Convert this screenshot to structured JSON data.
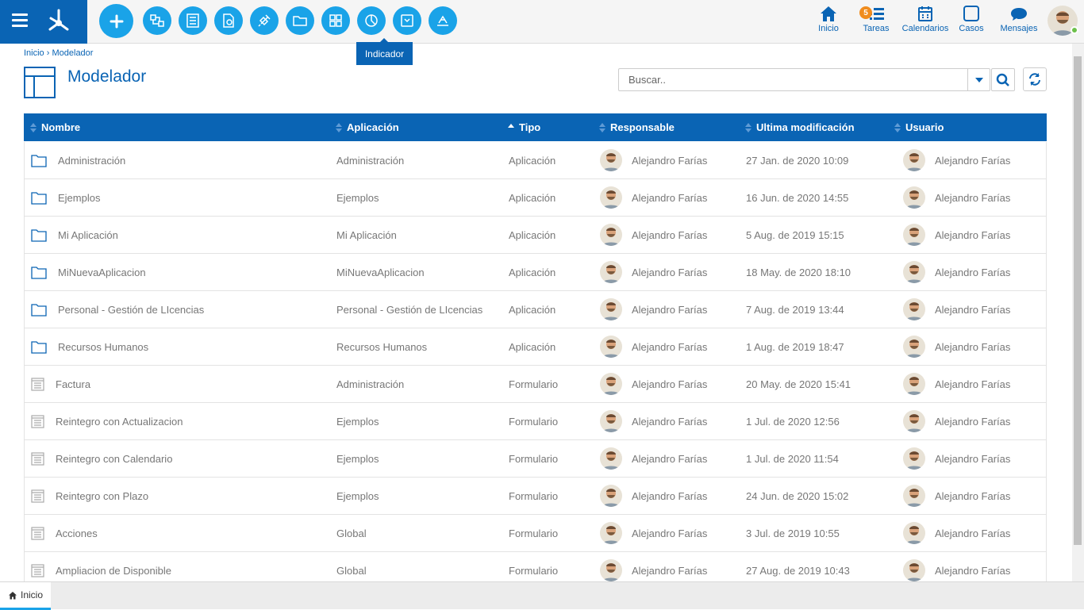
{
  "topbar": {
    "tooltip": "Indicador",
    "nav": [
      {
        "label": "Inicio",
        "icon": "home-icon"
      },
      {
        "label": "Tareas",
        "icon": "tasks-icon",
        "badge": "5"
      },
      {
        "label": "Calendarios",
        "icon": "calendar-icon"
      },
      {
        "label": "Casos",
        "icon": "cases-icon"
      },
      {
        "label": "Mensajes",
        "icon": "messages-icon"
      }
    ],
    "accent_color": "#0a64b4",
    "tool_color": "#1aa3e8"
  },
  "breadcrumb": {
    "home": "Inicio",
    "separator": "›",
    "current": "Modelador"
  },
  "page": {
    "title": "Modelador"
  },
  "search": {
    "placeholder": "Buscar.."
  },
  "table": {
    "headers": [
      "Nombre",
      "Aplicación",
      "Tipo",
      "Responsable",
      "Ultima modificación",
      "Usuario"
    ],
    "rows": [
      {
        "icon": "folder-icon",
        "name": "Administración",
        "app": "Administración",
        "type": "Aplicación",
        "resp": "Alejandro Farías",
        "mod": "27 Jan. de 2020 10:09",
        "user": "Alejandro Farías"
      },
      {
        "icon": "folder-icon",
        "name": "Ejemplos",
        "app": "Ejemplos",
        "type": "Aplicación",
        "resp": "Alejandro Farías",
        "mod": "16 Jun. de 2020 14:55",
        "user": "Alejandro Farías"
      },
      {
        "icon": "folder-icon",
        "name": "Mi Aplicación",
        "app": "Mi Aplicación",
        "type": "Aplicación",
        "resp": "Alejandro Farías",
        "mod": "5 Aug. de 2019 15:15",
        "user": "Alejandro Farías"
      },
      {
        "icon": "folder-icon",
        "name": "MiNuevaAplicacion",
        "app": "MiNuevaAplicacion",
        "type": "Aplicación",
        "resp": "Alejandro Farías",
        "mod": "18 May. de 2020 18:10",
        "user": "Alejandro Farías"
      },
      {
        "icon": "folder-icon",
        "name": "Personal - Gestión de LIcencias",
        "app": "Personal - Gestión de LIcencias",
        "type": "Aplicación",
        "resp": "Alejandro Farías",
        "mod": "7 Aug. de 2019 13:44",
        "user": "Alejandro Farías"
      },
      {
        "icon": "folder-icon",
        "name": "Recursos Humanos",
        "app": "Recursos Humanos",
        "type": "Aplicación",
        "resp": "Alejandro Farías",
        "mod": "1 Aug. de 2019 18:47",
        "user": "Alejandro Farías"
      },
      {
        "icon": "form-icon",
        "name": "Factura",
        "app": "Administración",
        "type": "Formulario",
        "resp": "Alejandro Farías",
        "mod": "20 May. de 2020 15:41",
        "user": "Alejandro Farías"
      },
      {
        "icon": "form-icon",
        "name": "Reintegro con Actualizacion",
        "app": "Ejemplos",
        "type": "Formulario",
        "resp": "Alejandro Farías",
        "mod": "1 Jul. de 2020 12:56",
        "user": "Alejandro Farías"
      },
      {
        "icon": "form-icon",
        "name": "Reintegro con Calendario",
        "app": "Ejemplos",
        "type": "Formulario",
        "resp": "Alejandro Farías",
        "mod": "1 Jul. de 2020 11:54",
        "user": "Alejandro Farías"
      },
      {
        "icon": "form-icon",
        "name": "Reintegro con Plazo",
        "app": "Ejemplos",
        "type": "Formulario",
        "resp": "Alejandro Farías",
        "mod": "24 Jun. de 2020 15:02",
        "user": "Alejandro Farías"
      },
      {
        "icon": "form-icon",
        "name": "Acciones",
        "app": "Global",
        "type": "Formulario",
        "resp": "Alejandro Farías",
        "mod": "3 Jul. de 2019 10:55",
        "user": "Alejandro Farías"
      },
      {
        "icon": "form-icon",
        "name": "Ampliacion de Disponible",
        "app": "Global",
        "type": "Formulario",
        "resp": "Alejandro Farías",
        "mod": "27 Aug. de 2019 10:43",
        "user": "Alejandro Farías"
      }
    ]
  },
  "footer": {
    "tab_label": "Inicio"
  }
}
